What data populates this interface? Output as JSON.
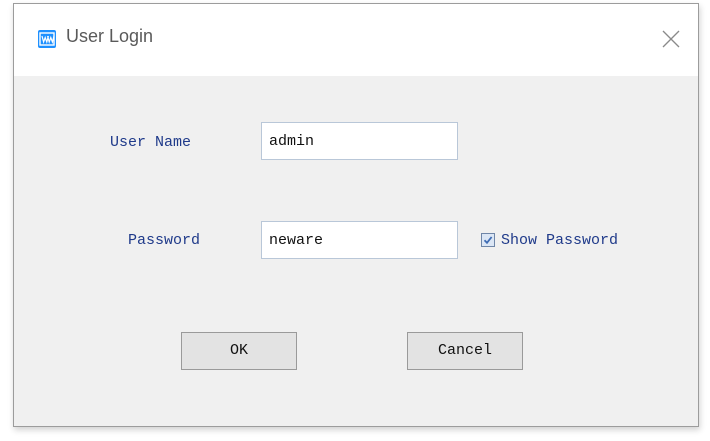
{
  "window": {
    "title": "User Login",
    "icon": "app-logo-icon",
    "close_icon": "close-icon"
  },
  "form": {
    "username_label": "User Name",
    "username_value": "admin",
    "password_label": "Password",
    "password_value": "neware",
    "show_password_label": "Show Password",
    "show_password_checked": true
  },
  "buttons": {
    "ok_label": "OK",
    "cancel_label": "Cancel"
  },
  "colors": {
    "label_text": "#1f3a8a",
    "accent": "#1e90ff"
  }
}
